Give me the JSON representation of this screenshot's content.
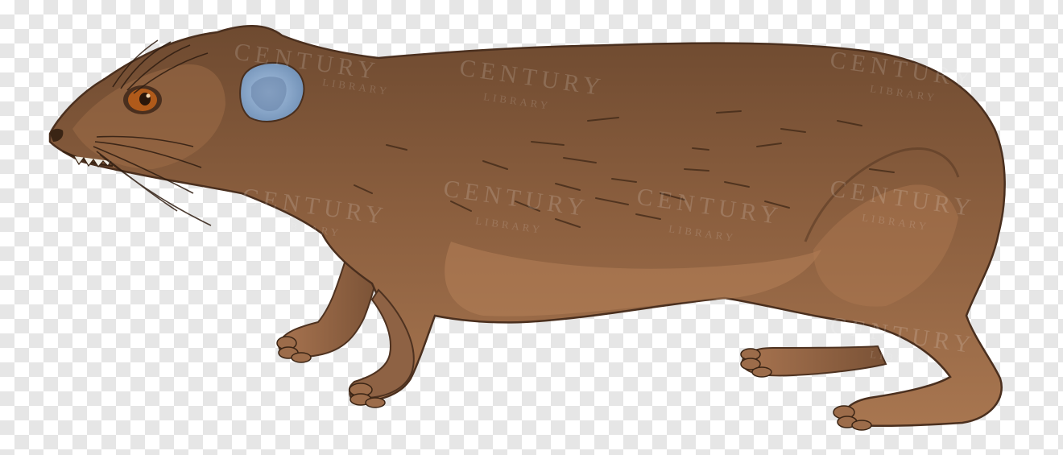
{
  "image": {
    "subject": "hyrax-engraving-icon",
    "background": "transparency-checkerboard",
    "colors": {
      "fur_base": "#8a5e3e",
      "fur_light": "#b07a52",
      "fur_dark": "#5a3a24",
      "ear": "#7f9fc4",
      "eye": "#b05a1a"
    }
  },
  "watermark": {
    "word": "CENTURY",
    "sub": "LIBRARY"
  }
}
